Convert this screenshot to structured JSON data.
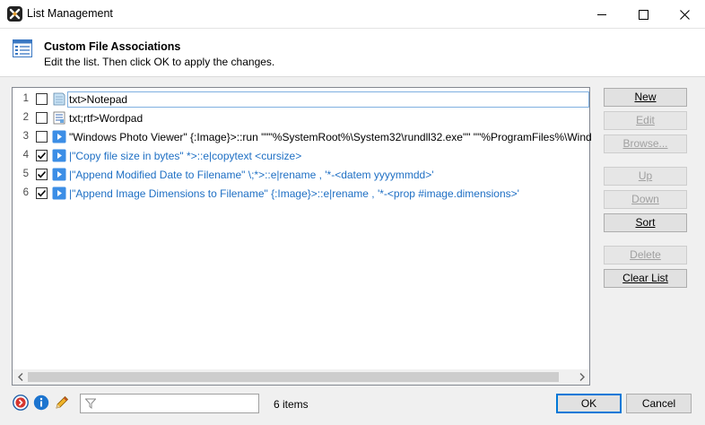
{
  "window": {
    "title": "List Management",
    "controls": {
      "minimize": "minimize-icon",
      "maximize": "maximize-icon",
      "close": "close-icon"
    }
  },
  "header": {
    "title": "Custom File Associations",
    "subtitle": "Edit the list. Then click OK to apply the changes."
  },
  "list": {
    "rows": [
      {
        "num": "1",
        "checked": false,
        "icon": "notepad-icon",
        "text": "txt>Notepad",
        "style": "normal",
        "selected": true
      },
      {
        "num": "2",
        "checked": false,
        "icon": "wordpad-icon",
        "text": "txt;rtf>Wordpad",
        "style": "normal",
        "selected": false
      },
      {
        "num": "3",
        "checked": false,
        "icon": "script-run-icon",
        "text": "\"Windows Photo Viewer\" {:Image}>::run \"\"\"%SystemRoot%\\System32\\rundll32.exe\"\" \"\"%ProgramFiles%\\Wind",
        "style": "normal",
        "selected": false
      },
      {
        "num": "4",
        "checked": true,
        "icon": "script-run-icon",
        "text": "|\"Copy file size in bytes\" *>::e|copytext <cursize>",
        "style": "blue",
        "selected": false
      },
      {
        "num": "5",
        "checked": true,
        "icon": "script-run-icon",
        "text": "|\"Append Modified Date to Filename\" \\;*>::e|rename , '*-<datem yyyymmdd>'",
        "style": "blue",
        "selected": false
      },
      {
        "num": "6",
        "checked": true,
        "icon": "script-run-icon",
        "text": "|\"Append Image Dimensions to Filename\" {:Image}>::e|rename , '*-<prop #image.dimensions>'",
        "style": "blue",
        "selected": false
      }
    ]
  },
  "side_buttons": {
    "new": "New",
    "edit": "Edit",
    "browse": "Browse...",
    "up": "Up",
    "down": "Down",
    "sort": "Sort",
    "delete": "Delete",
    "clear_list": "Clear List"
  },
  "footer": {
    "filter_placeholder": "",
    "item_count": "6 items",
    "ok": "OK",
    "cancel": "Cancel"
  },
  "colors": {
    "accent": "#0078d7",
    "script_text": "#1e6fc4",
    "play_icon": "#3c8ee6"
  }
}
